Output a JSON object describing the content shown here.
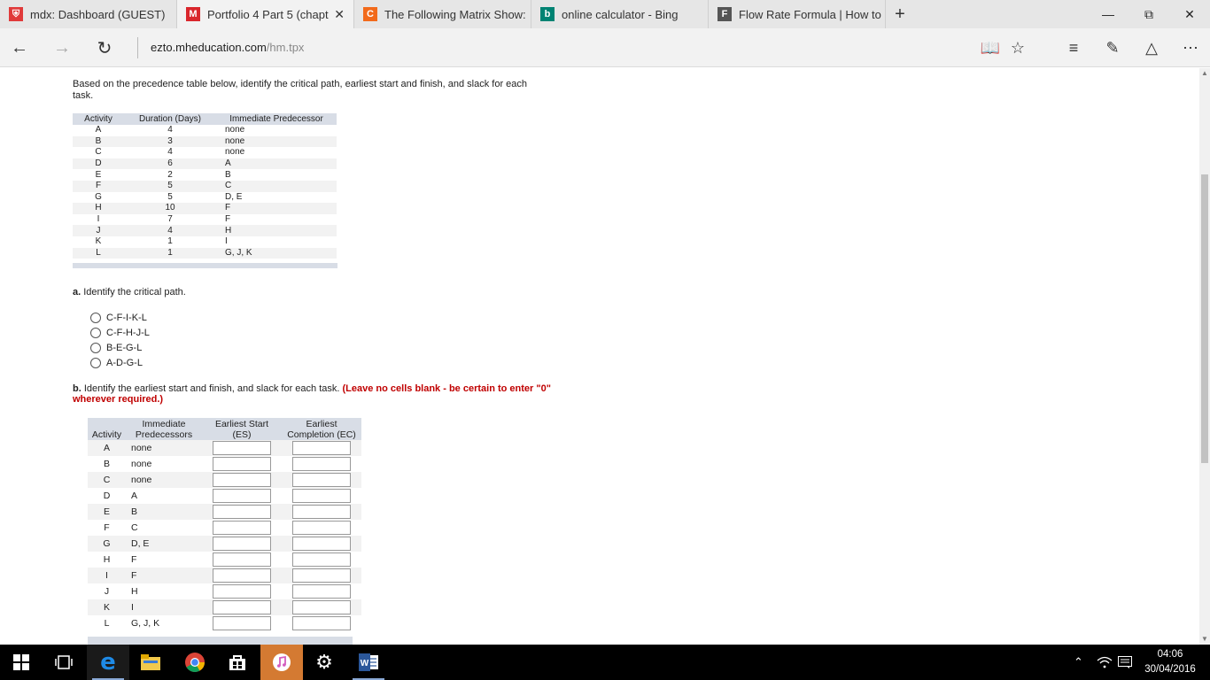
{
  "browser": {
    "tabs": [
      {
        "title": "mdx: Dashboard (GUEST)",
        "icon": "shield-favicon",
        "color": "#e03a3a"
      },
      {
        "title": "Portfolio 4 Part 5 (chapt",
        "icon": "mheducation-favicon",
        "color": "#d9262c",
        "letter": "M",
        "active": true
      },
      {
        "title": "The Following Matrix Show:",
        "icon": "chegg-favicon",
        "color": "#f26a1b",
        "letter": "C"
      },
      {
        "title": "online calculator - Bing",
        "icon": "bing-favicon",
        "color": "#008373",
        "letter": "b"
      },
      {
        "title": "Flow Rate Formula | How to",
        "icon": "formula-favicon",
        "color": "#555555",
        "letter": "F"
      }
    ],
    "url_domain": "ezto.mheducation.com",
    "url_path": "/hm.tpx"
  },
  "question": {
    "intro": "Based on the precedence table below, identify the critical path, earliest start and finish, and slack for each task.",
    "precedence_table": {
      "headers": [
        "Activity",
        "Duration (Days)",
        "Immediate Predecessor"
      ],
      "rows": [
        [
          "A",
          "4",
          "none"
        ],
        [
          "B",
          "3",
          "none"
        ],
        [
          "C",
          "4",
          "none"
        ],
        [
          "D",
          "6",
          "A"
        ],
        [
          "E",
          "2",
          "B"
        ],
        [
          "F",
          "5",
          "C"
        ],
        [
          "G",
          "5",
          "D, E"
        ],
        [
          "H",
          "10",
          "F"
        ],
        [
          "I",
          "7",
          "F"
        ],
        [
          "J",
          "4",
          "H"
        ],
        [
          "K",
          "1",
          "I"
        ],
        [
          "L",
          "1",
          "G, J, K"
        ]
      ]
    },
    "part_a": {
      "label": "a.",
      "text": "Identify the critical path.",
      "options": [
        "C-F-I-K-L",
        "C-F-H-J-L",
        "B-E-G-L",
        "A-D-G-L"
      ]
    },
    "part_b": {
      "label": "b.",
      "text": "Identify the earliest start and finish, and slack for each task.",
      "note": "(Leave no cells blank - be certain to enter \"0\" wherever required.)",
      "headers": {
        "activity": "Activity",
        "predecessors": "Immediate Predecessors",
        "es": "Earliest Start (ES)",
        "ec": "Earliest Completion (EC)"
      },
      "rows": [
        [
          "A",
          "none"
        ],
        [
          "B",
          "none"
        ],
        [
          "C",
          "none"
        ],
        [
          "D",
          "A"
        ],
        [
          "E",
          "B"
        ],
        [
          "F",
          "C"
        ],
        [
          "G",
          "D, E"
        ],
        [
          "H",
          "F"
        ],
        [
          "I",
          "F"
        ],
        [
          "J",
          "H"
        ],
        [
          "K",
          "I"
        ],
        [
          "L",
          "G, J, K"
        ]
      ]
    }
  },
  "taskbar": {
    "time": "04:06",
    "date": "30/04/2016"
  }
}
